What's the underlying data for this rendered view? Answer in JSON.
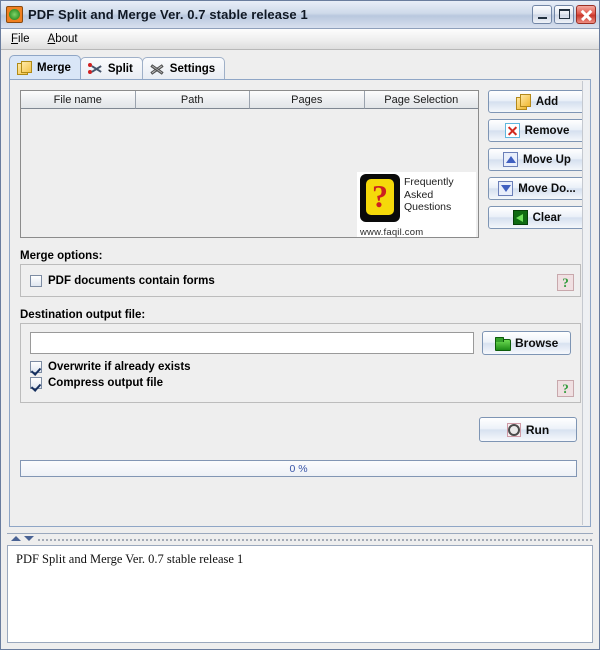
{
  "window": {
    "title": "PDF Split and Merge Ver. 0.7 stable release 1",
    "app_icon": "pdfsam-icon",
    "controls": {
      "minimize": "minimize-icon",
      "maximize": "maximize-icon",
      "close": "close-icon"
    }
  },
  "menubar": {
    "items": [
      {
        "label": "File",
        "mnemonic": "F"
      },
      {
        "label": "About",
        "mnemonic": "A"
      }
    ]
  },
  "tabs": [
    {
      "label": "Merge",
      "icon": "merge-pages-icon",
      "active": true
    },
    {
      "label": "Split",
      "icon": "split-scissors-icon",
      "active": false
    },
    {
      "label": "Settings",
      "icon": "wrench-screwdriver-icon",
      "active": false
    }
  ],
  "file_table": {
    "columns": [
      "File name",
      "Path",
      "Pages",
      "Page Selection"
    ],
    "rows": []
  },
  "faq_banner": {
    "line1": "Frequently",
    "line2": "Asked",
    "line3": "Questions",
    "question_mark": "?",
    "url": "www.faqil.com"
  },
  "side_buttons": [
    {
      "label": "Add",
      "icon": "add-pages-icon"
    },
    {
      "label": "Remove",
      "icon": "remove-x-icon"
    },
    {
      "label": "Move Up",
      "icon": "move-up-icon"
    },
    {
      "label": "Move Do...",
      "icon": "move-down-icon"
    },
    {
      "label": "Clear",
      "icon": "clear-arrow-icon"
    }
  ],
  "merge_options": {
    "label": "Merge options:",
    "checkbox": {
      "label": "PDF documents contain forms",
      "checked": false
    },
    "help_icon": "help-question-icon",
    "help_glyph": "?"
  },
  "destination": {
    "label": "Destination output file:",
    "input": {
      "value": "",
      "placeholder": ""
    },
    "browse_button": {
      "label": "Browse",
      "icon": "open-folder-icon"
    },
    "checkboxes": [
      {
        "label": "Overwrite if already exists",
        "checked": true
      },
      {
        "label": "Compress output file",
        "checked": true
      }
    ],
    "help_icon": "help-question-icon",
    "help_glyph": "?"
  },
  "run": {
    "label": "Run",
    "icon": "gear-icon"
  },
  "progress": {
    "text": "0 %",
    "percent": 0
  },
  "splitter": {
    "collapse_up_icon": "triangle-up-icon",
    "collapse_down_icon": "triangle-down-icon"
  },
  "log": {
    "lines": [
      "PDF Split and Merge Ver. 0.7 stable release 1"
    ],
    "line1": "PDF Split and Merge Ver. 0.7 stable release 1"
  },
  "colors": {
    "titlebar": "#cfdaea",
    "active_tab": "#d9e6f7",
    "panel_border": "#8fa6c6",
    "close_button": "#e1584b",
    "progress_text": "#3a56a8",
    "faq_yellow": "#f5d90a",
    "faq_red": "#cc2020"
  }
}
